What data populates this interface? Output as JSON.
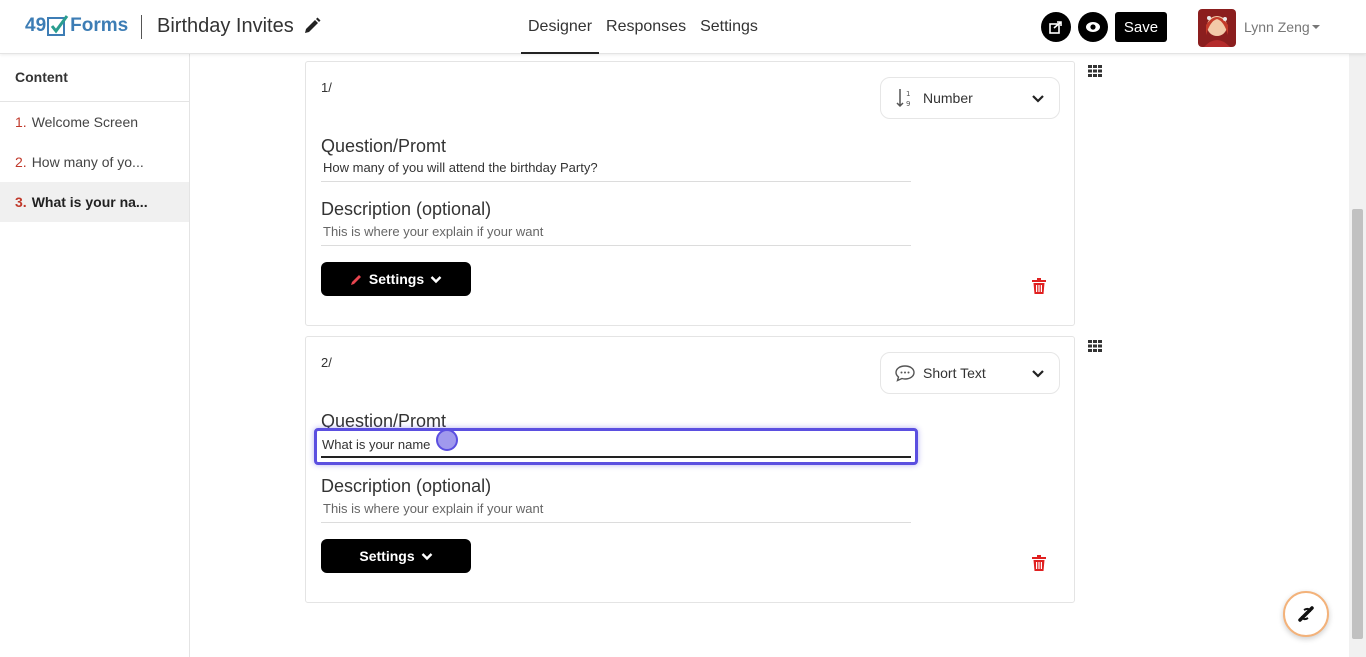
{
  "header": {
    "logo_num": "49",
    "logo_text": "Forms",
    "form_title": "Birthday Invites",
    "tabs": [
      {
        "label": "Designer"
      },
      {
        "label": "Responses"
      },
      {
        "label": "Settings"
      }
    ],
    "save_label": "Save",
    "user_name": "Lynn Zeng"
  },
  "sidebar": {
    "title": "Content",
    "items": [
      {
        "num": "1.",
        "label": "Welcome Screen"
      },
      {
        "num": "2.",
        "label": "How many of yo..."
      },
      {
        "num": "3.",
        "label": "What is your na..."
      }
    ]
  },
  "questions": [
    {
      "num": "1/",
      "type": "Number",
      "prompt_label": "Question/Promt",
      "prompt_value": "How many of you will attend the birthday Party?",
      "desc_label": "Description (optional)",
      "desc_placeholder": "This is where your explain if your want",
      "settings_label": "Settings"
    },
    {
      "num": "2/",
      "type": "Short Text",
      "prompt_label": "Question/Promt",
      "prompt_value": "What is your name",
      "desc_label": "Description (optional)",
      "desc_placeholder": "This is where your explain if your want",
      "settings_label": "Settings"
    }
  ],
  "colors": {
    "accent_focus": "#5b4fe0",
    "delete_red": "#e02020",
    "sidebar_num": "#c0392b",
    "logo_blue": "#3d7db5",
    "logo_green": "#2a9d8f"
  }
}
